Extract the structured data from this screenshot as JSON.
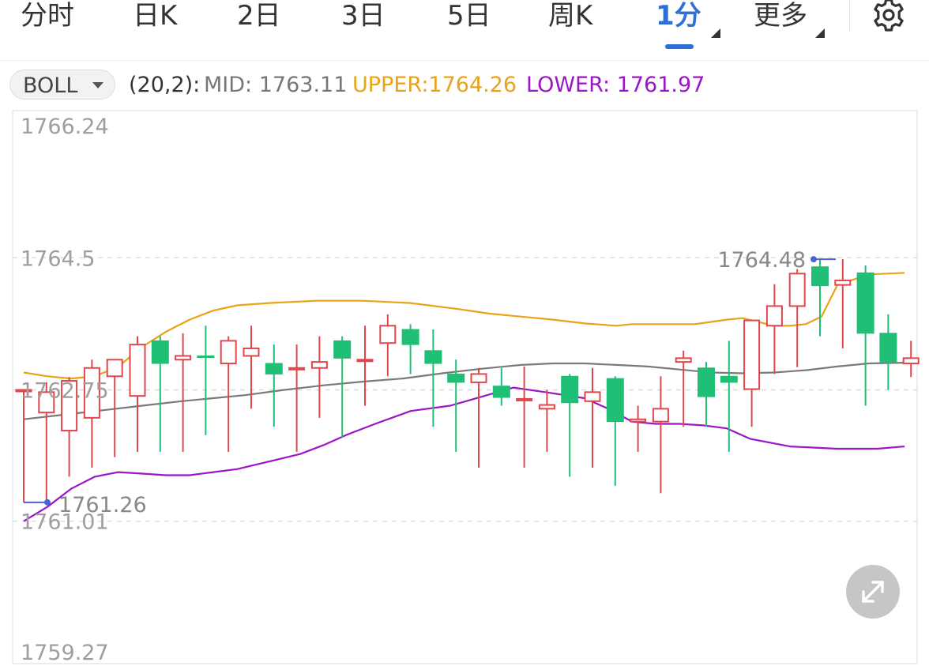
{
  "tabs": [
    {
      "label": "分时",
      "active": false
    },
    {
      "label": "日K",
      "active": false
    },
    {
      "label": "2日",
      "active": false
    },
    {
      "label": "3日",
      "active": false
    },
    {
      "label": "5日",
      "active": false
    },
    {
      "label": "周K",
      "active": false
    },
    {
      "label": "1分",
      "active": true
    },
    {
      "label": "更多",
      "active": false
    }
  ],
  "settings_icon": "gear-icon",
  "indicator": {
    "name": "BOLL",
    "params": "(20,2):",
    "mid": "MID: 1763.11",
    "upper": "UPPER:1764.26",
    "lower": "LOWER: 1761.97"
  },
  "colors": {
    "accent": "#2f6fd8",
    "up": "#e0474c",
    "down": "#1fbf75",
    "upper_line": "#e8a317",
    "mid_line": "#7a7a7a",
    "lower_line": "#9c15c7",
    "marker": "#4a62d8"
  },
  "expand_icon": "expand-arrows-icon",
  "chart_data": {
    "type": "candlestick",
    "y_tick_labels": [
      "1766.24",
      "1764.5",
      "1762.75",
      "1761.01",
      "1759.27"
    ],
    "y_ticks": [
      1766.24,
      1764.5,
      1762.75,
      1761.01,
      1759.27
    ],
    "ylim": [
      1759.27,
      1766.24
    ],
    "grid": "dashed horizontal",
    "max_label": "1764.48",
    "min_label": "1761.26",
    "max_value": 1764.48,
    "min_value": 1761.26,
    "candles": [
      {
        "o": 1762.75,
        "h": 1762.75,
        "l": 1761.26,
        "c": 1762.75
      },
      {
        "o": 1762.45,
        "h": 1762.85,
        "l": 1761.26,
        "c": 1762.72
      },
      {
        "o": 1762.21,
        "h": 1762.92,
        "l": 1761.6,
        "c": 1762.87
      },
      {
        "o": 1762.38,
        "h": 1763.15,
        "l": 1761.72,
        "c": 1763.04
      },
      {
        "o": 1762.93,
        "h": 1763.15,
        "l": 1761.86,
        "c": 1763.15
      },
      {
        "o": 1762.67,
        "h": 1763.46,
        "l": 1761.93,
        "c": 1763.35
      },
      {
        "o": 1763.4,
        "h": 1763.46,
        "l": 1761.93,
        "c": 1763.1
      },
      {
        "o": 1763.15,
        "h": 1763.5,
        "l": 1761.93,
        "c": 1763.2
      },
      {
        "o": 1763.2,
        "h": 1763.6,
        "l": 1762.15,
        "c": 1763.19
      },
      {
        "o": 1763.1,
        "h": 1763.46,
        "l": 1761.93,
        "c": 1763.4
      },
      {
        "o": 1763.2,
        "h": 1763.6,
        "l": 1762.5,
        "c": 1763.3
      },
      {
        "o": 1763.1,
        "h": 1763.35,
        "l": 1762.26,
        "c": 1762.96
      },
      {
        "o": 1763.04,
        "h": 1763.35,
        "l": 1761.93,
        "c": 1763.04
      },
      {
        "o": 1763.04,
        "h": 1763.46,
        "l": 1762.38,
        "c": 1763.12
      },
      {
        "o": 1763.4,
        "h": 1763.46,
        "l": 1762.12,
        "c": 1763.17
      },
      {
        "o": 1763.15,
        "h": 1763.6,
        "l": 1762.54,
        "c": 1763.15
      },
      {
        "o": 1763.37,
        "h": 1763.75,
        "l": 1762.93,
        "c": 1763.6
      },
      {
        "o": 1763.55,
        "h": 1763.62,
        "l": 1762.96,
        "c": 1763.35
      },
      {
        "o": 1763.27,
        "h": 1763.55,
        "l": 1762.26,
        "c": 1763.1
      },
      {
        "o": 1762.96,
        "h": 1763.15,
        "l": 1761.93,
        "c": 1762.85
      },
      {
        "o": 1762.85,
        "h": 1763.04,
        "l": 1761.72,
        "c": 1762.96
      },
      {
        "o": 1762.8,
        "h": 1763.04,
        "l": 1762.54,
        "c": 1762.65
      },
      {
        "o": 1762.63,
        "h": 1763.06,
        "l": 1761.72,
        "c": 1762.63
      },
      {
        "o": 1762.5,
        "h": 1762.75,
        "l": 1761.93,
        "c": 1762.55
      },
      {
        "o": 1762.93,
        "h": 1762.96,
        "l": 1761.6,
        "c": 1762.58
      },
      {
        "o": 1762.6,
        "h": 1763.04,
        "l": 1761.72,
        "c": 1762.72
      },
      {
        "o": 1762.9,
        "h": 1762.93,
        "l": 1761.48,
        "c": 1762.33
      },
      {
        "o": 1762.33,
        "h": 1762.54,
        "l": 1761.93,
        "c": 1762.36
      },
      {
        "o": 1762.33,
        "h": 1762.93,
        "l": 1761.38,
        "c": 1762.5
      },
      {
        "o": 1763.12,
        "h": 1763.27,
        "l": 1762.26,
        "c": 1763.17
      },
      {
        "o": 1763.04,
        "h": 1763.12,
        "l": 1762.26,
        "c": 1762.66
      },
      {
        "o": 1762.93,
        "h": 1763.4,
        "l": 1761.93,
        "c": 1762.85
      },
      {
        "o": 1762.76,
        "h": 1763.6,
        "l": 1762.26,
        "c": 1763.67
      },
      {
        "o": 1763.6,
        "h": 1764.15,
        "l": 1762.96,
        "c": 1763.86
      },
      {
        "o": 1763.86,
        "h": 1764.35,
        "l": 1763.05,
        "c": 1764.29
      },
      {
        "o": 1764.38,
        "h": 1764.48,
        "l": 1763.46,
        "c": 1764.13
      },
      {
        "o": 1764.14,
        "h": 1764.48,
        "l": 1763.3,
        "c": 1764.2
      },
      {
        "o": 1764.3,
        "h": 1764.4,
        "l": 1762.54,
        "c": 1763.5
      },
      {
        "o": 1763.5,
        "h": 1763.75,
        "l": 1762.75,
        "c": 1763.12
      },
      {
        "o": 1763.1,
        "h": 1763.4,
        "l": 1762.92,
        "c": 1763.17
      }
    ],
    "upper": [
      1762.98,
      1762.93,
      1762.9,
      1762.93,
      1763.06,
      1763.32,
      1763.52,
      1763.68,
      1763.8,
      1763.87,
      1763.9,
      1763.93,
      1763.93,
      1763.9,
      1763.82,
      1763.76,
      1763.72,
      1763.68,
      1763.63,
      1763.6,
      1763.62,
      1763.62,
      1763.62,
      1763.68,
      1763.7,
      1763.65,
      1763.6,
      1763.6,
      1763.62,
      1763.72,
      1764.14,
      1764.28,
      1764.3
    ],
    "upper_x": [
      30,
      60,
      90,
      120,
      150,
      180,
      210,
      240,
      270,
      300,
      340,
      400,
      460,
      520,
      580,
      620,
      660,
      700,
      740,
      780,
      800,
      840,
      880,
      920,
      940,
      960,
      980,
      1000,
      1020,
      1040,
      1060,
      1100,
      1145
    ],
    "mid": [
      1762.36,
      1762.42,
      1762.48,
      1762.54,
      1762.6,
      1762.64,
      1762.68,
      1762.75,
      1762.81,
      1762.86,
      1762.9,
      1762.97,
      1763.03,
      1763.08,
      1763.1,
      1763.1,
      1763.08,
      1763.06,
      1763.02,
      1762.98,
      1762.97,
      1762.98,
      1763.01,
      1763.06,
      1763.1,
      1763.11
    ],
    "mid_x": [
      30,
      80,
      130,
      180,
      230,
      270,
      310,
      360,
      410,
      460,
      510,
      560,
      610,
      660,
      700,
      740,
      780,
      820,
      860,
      900,
      940,
      980,
      1020,
      1060,
      1100,
      1145
    ],
    "lower": [
      1761.01,
      1761.2,
      1761.44,
      1761.6,
      1761.66,
      1761.64,
      1761.62,
      1761.62,
      1761.66,
      1761.7,
      1761.8,
      1761.9,
      1762.02,
      1762.16,
      1762.32,
      1762.47,
      1762.54,
      1762.66,
      1762.78,
      1762.72,
      1762.64,
      1762.5,
      1762.33,
      1762.3,
      1762.3,
      1762.28,
      1762.24,
      1762.1,
      1762.0,
      1761.97,
      1761.97,
      1762.0
    ],
    "lower_x": [
      30,
      60,
      90,
      120,
      150,
      180,
      210,
      240,
      270,
      300,
      340,
      380,
      410,
      440,
      480,
      520,
      570,
      610,
      650,
      690,
      740,
      770,
      800,
      830,
      860,
      890,
      920,
      950,
      1000,
      1060,
      1110,
      1145
    ]
  }
}
